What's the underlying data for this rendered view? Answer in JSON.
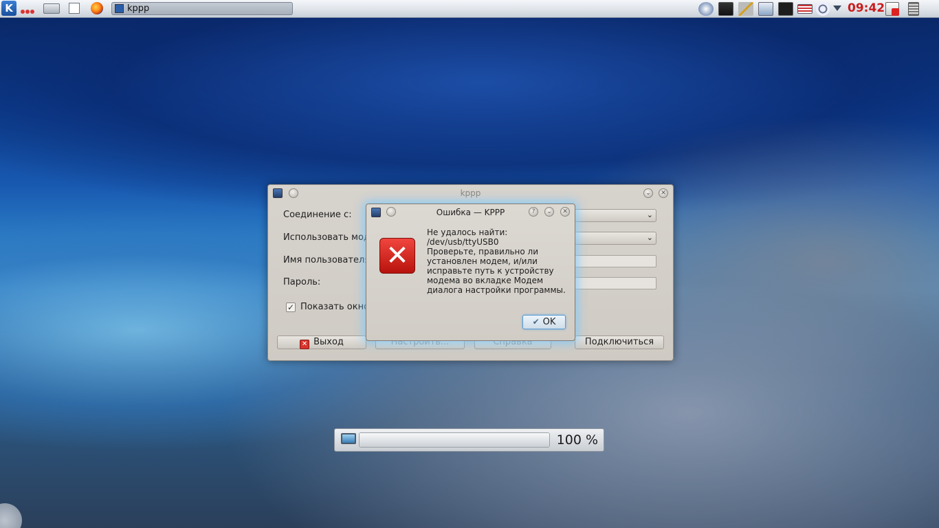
{
  "panel": {
    "task_label": "kppp",
    "clock": "09:42"
  },
  "kppp_window": {
    "title": "kppp",
    "rows": [
      {
        "label": "Соединение с:"
      },
      {
        "label": "Использовать мод"
      },
      {
        "label": "Имя пользователя"
      },
      {
        "label": "Пароль:"
      }
    ],
    "checkbox_label": "Показать окно",
    "buttons": {
      "exit": "Выход",
      "configure": "Настроить...",
      "help": "Справка",
      "connect": "Подключиться"
    }
  },
  "error_dialog": {
    "title": "Ошибка — KPPP",
    "help_glyph": "?",
    "message": "Не удалось найти:\n /dev/usb/ttyUSB0\nПроверьте, правильно ли установлен модем, и/или исправьте путь к устройству модема во вкладке Модем диалога настройки программы.",
    "ok_label": "OK"
  },
  "volume_osd": {
    "percent_label": "100 %",
    "level": 1.0
  },
  "colors": {
    "accent_clock": "#c81e1e",
    "dialog_glow": "#78c8ff"
  }
}
